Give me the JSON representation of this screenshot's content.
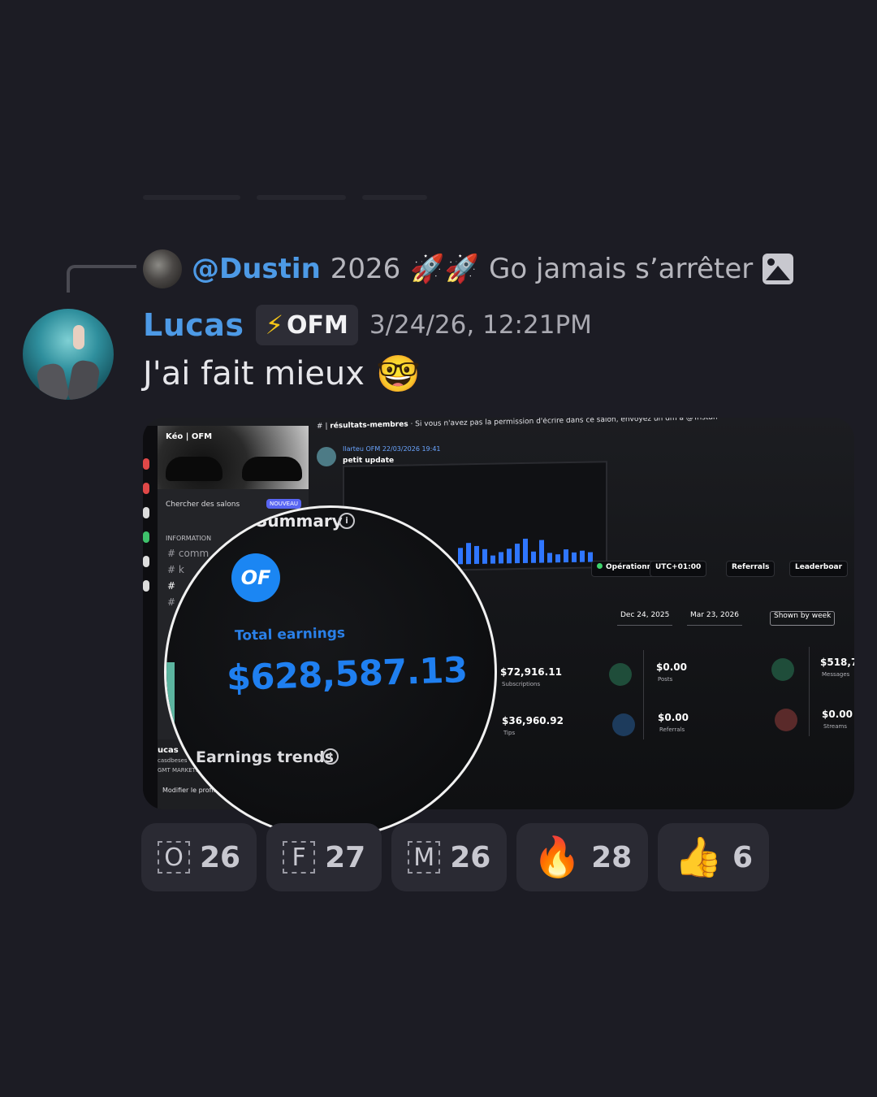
{
  "reply": {
    "username": "@Dustin",
    "text_before": "2026",
    "rocket_emoji": "🚀🚀",
    "text_after": "Go jamais s’arrêter"
  },
  "message": {
    "username": "Lucas",
    "tag_icon": "⚡",
    "tag": "OFM",
    "timestamp": "3/24/26, 12:21PM",
    "text": "J'ai fait mieux",
    "emoji": "🤓"
  },
  "attachment": {
    "server_name": "Kéo | OFM",
    "search_label": "Chercher des salons",
    "new_badge": "NOUVEAU",
    "info_category": "INFORMATION",
    "channel_prefix": "#",
    "channels": [
      "comm",
      "k",
      "",
      ""
    ],
    "channel_name": "résultats-membres",
    "channel_topic": "Si vous n'avez pas la permission d'écrire dans ce salon, envoyez un dm à @Tristan",
    "inner_author": "Ilarteu",
    "inner_tag": "OFM",
    "inner_timestamp": "22/03/2026 19:41",
    "inner_text": "petit update",
    "user_panel_name": "ucas",
    "user_panel_handle": "casdbeses",
    "user_panel_company": "GMT MARKETIN",
    "edit_profile": "Modifier le profil",
    "status_operational": "Opérationnel",
    "timezone": "UTC+01:00",
    "referrals_label": "Referrals",
    "leaderboard_label": "Leaderboar",
    "date_start": "Dec 24, 2025",
    "date_end": "Mar 23, 2026",
    "shown_by": "Shown by week",
    "stats": [
      {
        "value": "$72,916.11",
        "label": "Subscriptions"
      },
      {
        "value": "$0.00",
        "label": "Posts"
      },
      {
        "value": "$518,7",
        "label": "Messages"
      },
      {
        "value": "$36,960.92",
        "label": "Tips"
      },
      {
        "value": "$0.00",
        "label": "Referrals"
      },
      {
        "value": "$0.00",
        "label": "Streams"
      }
    ],
    "colors": {
      "accent_blue": "#1f7ff0",
      "stat_green": "#1f4d3a",
      "stat_red": "#5a2a2a",
      "stat_blue": "#1d3b5c"
    }
  },
  "magnifier": {
    "summary_label": "Summary",
    "total_earnings_label": "Total earnings",
    "total_earnings_value": "$628,587.13",
    "earnings_trends_label": "Earnings trends",
    "logo_text": "OF",
    "info_icon": "i"
  },
  "reactions": [
    {
      "kind": "letter",
      "symbol": "O",
      "count": "26"
    },
    {
      "kind": "letter",
      "symbol": "F",
      "count": "27"
    },
    {
      "kind": "letter",
      "symbol": "M",
      "count": "26"
    },
    {
      "kind": "emoji",
      "symbol": "🔥",
      "count": "28"
    },
    {
      "kind": "emoji",
      "symbol": "👍",
      "count": "6"
    }
  ],
  "icons": {
    "image": "image-icon",
    "bolt": "lightning-bolt-icon",
    "info": "info-icon"
  }
}
